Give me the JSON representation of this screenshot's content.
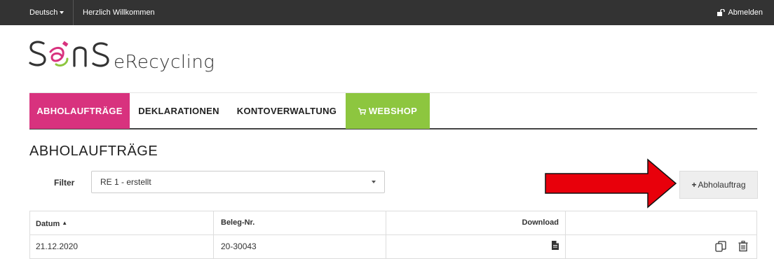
{
  "topbar": {
    "language": "Deutsch",
    "welcome": "Herzlich Willkommen",
    "logout": "Abmelden"
  },
  "logo": {
    "text": "eRecycling",
    "brand_colors": {
      "magenta": "#d8327e",
      "green": "#8dc63f",
      "dark": "#333333"
    }
  },
  "nav": {
    "items": [
      {
        "label": "ABHOLAUFTRÄGE",
        "active": true
      },
      {
        "label": "DEKLARATIONEN",
        "active": false
      },
      {
        "label": "KONTOVERWALTUNG",
        "active": false
      },
      {
        "label": "WEBSHOP",
        "icon": "cart-icon",
        "active": false
      }
    ]
  },
  "main": {
    "title": "ABHOLAUFTRÄGE",
    "filter_label": "Filter",
    "filter_value": "RE 1 - erstellt",
    "add_button": "Abholauftrag"
  },
  "table": {
    "headers": [
      "Datum",
      "Beleg-Nr.",
      "Download",
      ""
    ],
    "rows": [
      {
        "datum": "21.12.2020",
        "beleg": "20-30043"
      }
    ]
  },
  "annotation": {
    "arrow_color": "#e8000b",
    "arrow_target": "add-abholauftrag-button"
  }
}
